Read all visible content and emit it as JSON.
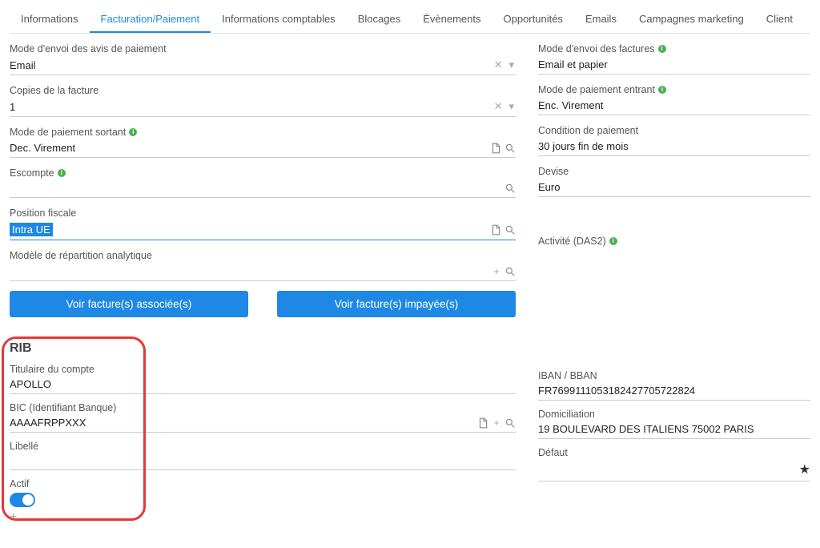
{
  "tabs": [
    "Informations",
    "Facturation/Paiement",
    "Informations comptables",
    "Blocages",
    "Évènements",
    "Opportunités",
    "Emails",
    "Campagnes marketing",
    "Client"
  ],
  "activeTab": 1,
  "left": {
    "mode_envoi_avis": {
      "label": "Mode d'envoi des avis de paiement",
      "value": "Email"
    },
    "copies": {
      "label": "Copies de la facture",
      "value": "1"
    },
    "mode_paiement_sortant": {
      "label": "Mode de paiement sortant",
      "value": "Dec. Virement"
    },
    "escompte": {
      "label": "Escompte",
      "value": ""
    },
    "position_fiscale": {
      "label": "Position fiscale",
      "value": "Intra UE"
    },
    "modele_repartition": {
      "label": "Modèle de répartition analytique",
      "value": ""
    }
  },
  "right": {
    "mode_envoi_factures": {
      "label": "Mode d'envoi des factures",
      "value": "Email et papier"
    },
    "mode_paiement_entrant": {
      "label": "Mode de paiement entrant",
      "value": "Enc. Virement"
    },
    "condition_paiement": {
      "label": "Condition de paiement",
      "value": "30 jours fin de mois"
    },
    "devise": {
      "label": "Devise",
      "value": "Euro"
    },
    "activite_das2": {
      "label": "Activité (DAS2)",
      "value": ""
    }
  },
  "buttons": {
    "voir_associees": "Voir facture(s) associée(s)",
    "voir_impayees": "Voir facture(s) impayée(s)"
  },
  "rib": {
    "title": "RIB",
    "titulaire": {
      "label": "Titulaire du compte",
      "value": "APOLLO"
    },
    "bic": {
      "label": "BIC (Identifiant Banque)",
      "value": "AAAAFRPPXXX"
    },
    "libelle": {
      "label": "Libellé",
      "value": ""
    },
    "actif": {
      "label": "Actif",
      "value": true
    },
    "iban": {
      "label": "IBAN / BBAN",
      "value": "FR7699111053182427705722824"
    },
    "domiciliation": {
      "label": "Domiciliation",
      "value": "19 BOULEVARD DES ITALIENS 75002 PARIS"
    },
    "defaut": {
      "label": "Défaut",
      "value": ""
    }
  }
}
